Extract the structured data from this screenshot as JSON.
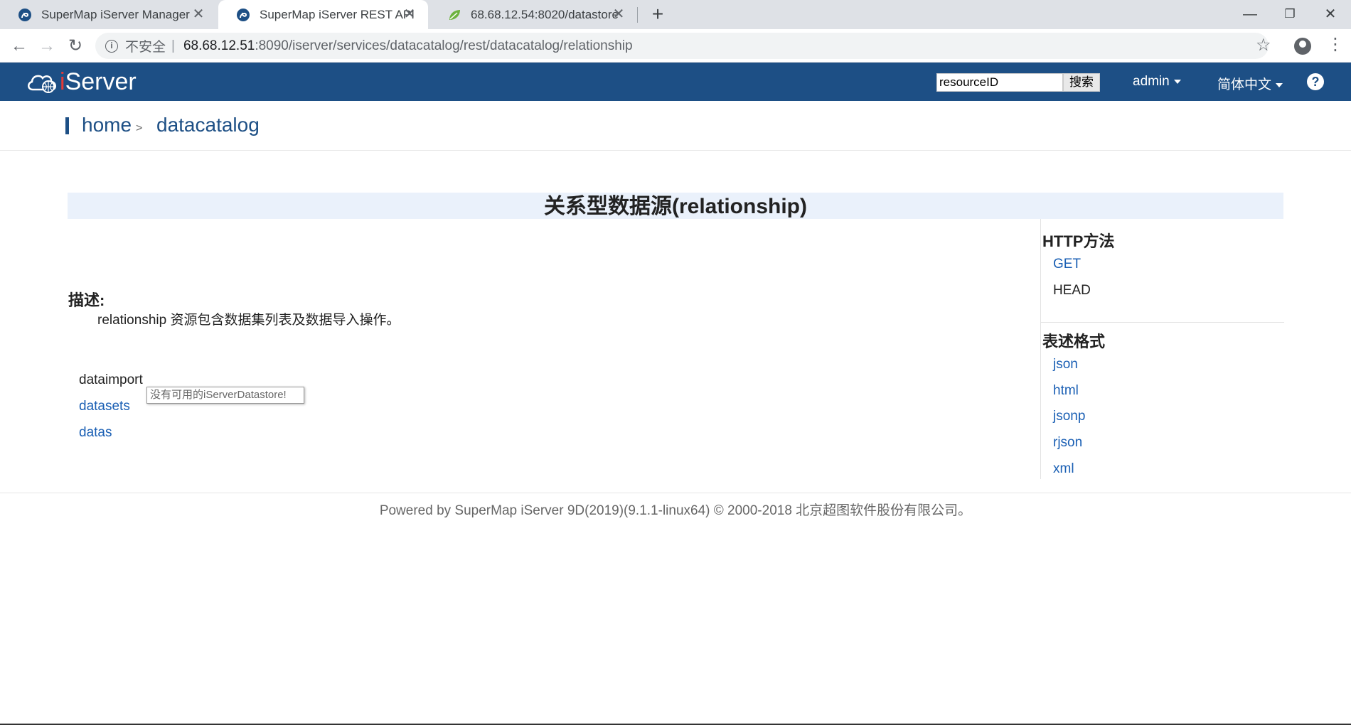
{
  "browser": {
    "tabs": [
      {
        "title": "SuperMap iServer Manager",
        "favicon": "supermap-icon",
        "active": false
      },
      {
        "title": "SuperMap iServer REST API",
        "favicon": "supermap-icon",
        "active": true
      },
      {
        "title": "68.68.12.54:8020/datastore",
        "favicon": "leaf-icon",
        "active": false
      }
    ],
    "address": {
      "security_label": "不安全",
      "host": "68.68.12.51",
      "path": ":8090/iserver/services/datacatalog/rest/datacatalog/relationship"
    }
  },
  "header": {
    "logo_prefix": "i",
    "logo_text": "Server",
    "search_value": "resourceID",
    "search_button": "搜索",
    "user_menu": "admin",
    "language_menu": "简体中文",
    "help": "?"
  },
  "breadcrumb": {
    "home": "home",
    "separator": ">",
    "current": "datacatalog"
  },
  "main": {
    "title": "关系型数据源(relationship)",
    "description_heading": "描述:",
    "description_text": "relationship 资源包含数据集列表及数据导入操作。",
    "children": [
      {
        "label": "dataimport",
        "link": false
      },
      {
        "label": "datasets",
        "link": true
      },
      {
        "label": "datas",
        "link": true
      }
    ],
    "tooltip": "没有可用的iServerDatastore!"
  },
  "sidebar": {
    "http_methods_title": "HTTP方法",
    "http_methods": [
      {
        "label": "GET",
        "link": true
      },
      {
        "label": "HEAD",
        "link": false
      }
    ],
    "formats_title": "表述格式",
    "formats": [
      "json",
      "html",
      "jsonp",
      "rjson",
      "xml"
    ]
  },
  "footer": {
    "text": "Powered by SuperMap iServer 9D(2019)(9.1.1-linux64) © 2000-2018 北京超图软件股份有限公司。"
  },
  "colors": {
    "header_bg": "#1d4f85",
    "link": "#1a5fb4",
    "title_band": "#eaf1fb"
  }
}
